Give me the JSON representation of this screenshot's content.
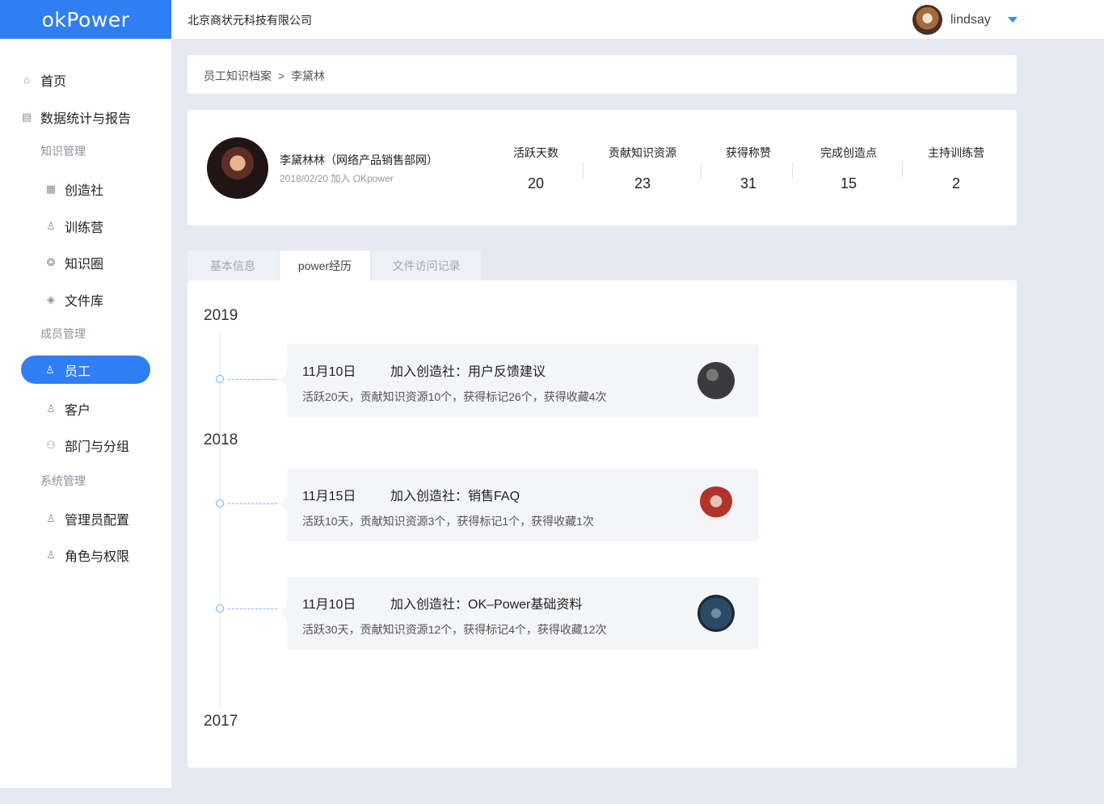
{
  "app": {
    "logo": "okPower",
    "company": "北京商状元科技有限公司"
  },
  "user": {
    "name": "lindsay"
  },
  "sidebar": {
    "home": "首页",
    "reports": "数据统计与报告",
    "group_knowledge": "知识管理",
    "chuangzaoshe": "创造社",
    "xunlianying": "训练营",
    "zhishiquan": "知识圈",
    "wenjianku": "文件库",
    "group_members": "成员管理",
    "yuangong": "员工",
    "kehu": "客户",
    "bumen": "部门与分组",
    "group_system": "系统管理",
    "admin": "管理员配置",
    "roles": "角色与权限"
  },
  "breadcrumb": {
    "parent": "员工知识档案",
    "sep": ">",
    "current": "李黛林"
  },
  "profile": {
    "name": "李黛林林（网络产品销售部网）",
    "join": "2018/02/20 加入 OKpower",
    "stats": [
      {
        "label": "活跃天数",
        "value": "20"
      },
      {
        "label": "贡献知识资源",
        "value": "23"
      },
      {
        "label": "获得称赞",
        "value": "31"
      },
      {
        "label": "完成创造点",
        "value": "15"
      },
      {
        "label": "主持训练营",
        "value": "2"
      }
    ]
  },
  "tabs": [
    {
      "label": "基本信息",
      "active": false
    },
    {
      "label": "power经历",
      "active": true
    },
    {
      "label": "文件访问记录",
      "active": false
    }
  ],
  "timeline": {
    "years": [
      "2019",
      "2018",
      "2017"
    ],
    "entries": [
      {
        "date": "11月10日",
        "title": "加入创造社：用户反馈建议",
        "desc": "活跃20天，贡献知识资源10个，获得标记26个，获得收藏4次",
        "thumb_color": "#3b3b3e"
      },
      {
        "date": "11月15日",
        "title": "加入创造社：销售FAQ",
        "desc": "活跃10天，贡献知识资源3个，获得标记1个，获得收藏1次",
        "thumb_color": "#b0332c"
      },
      {
        "date": "11月10日",
        "title": "加入创造社：OK–Power基础资料",
        "desc": "活跃30天，贡献知识资源12个，获得标记4个，获得收藏12次",
        "thumb_color": "#2b4a63"
      }
    ]
  }
}
